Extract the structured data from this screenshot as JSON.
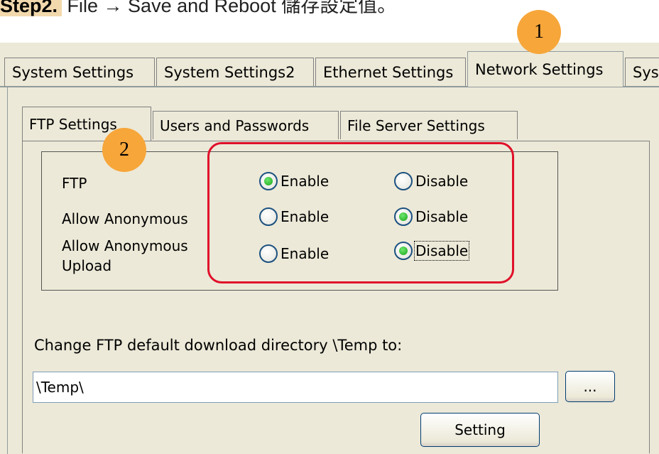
{
  "header": {
    "step_label": "Step2.",
    "step_text": " File → Save and Reboot 儲存設定值。"
  },
  "top_tabs": [
    "System Settings",
    "System Settings2",
    "Ethernet Settings",
    "Network Settings",
    "Sys"
  ],
  "inner_tabs": [
    "FTP Settings",
    "Users and Passwords",
    "File Server Settings"
  ],
  "options": {
    "rows": [
      {
        "label": "FTP",
        "enable": "Enable",
        "disable": "Disable",
        "selected": "Enable"
      },
      {
        "label": "Allow Anonymous",
        "enable": "Enable",
        "disable": "Disable",
        "selected": "Disable"
      },
      {
        "label_line1": "Allow Anonymous",
        "label_line2": "Upload",
        "enable": "Enable",
        "disable": "Disable",
        "selected": "Disable"
      }
    ]
  },
  "directory": {
    "label": "Change FTP default download directory \\Temp to:",
    "value": "\\Temp\\",
    "browse_label": "...",
    "setting_label": "Setting"
  },
  "callouts": {
    "one": "1",
    "two": "2"
  },
  "colors": {
    "highlight_box": "#e0102a",
    "callout": "#f7a63a",
    "panel": "#ece9d8"
  }
}
